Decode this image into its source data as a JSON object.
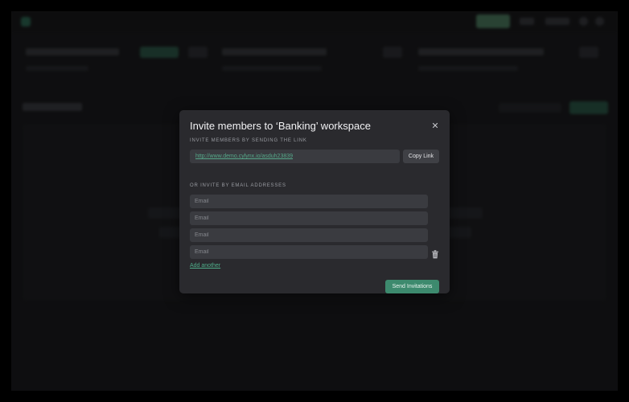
{
  "modal": {
    "title": "Invite members to ‘Banking’ workspace",
    "close_icon": "close-icon",
    "link_section_label": "INVITE MEMBERS BY SENDING THE LINK",
    "invite_link": "http://www.demo.cylynx.io/asduh23839",
    "copy_link_label": "Copy Link",
    "email_section_label": "OR INVITE BY EMAIL ADDRESSES",
    "email_fields": [
      {
        "placeholder": "Email",
        "value": ""
      },
      {
        "placeholder": "Email",
        "value": ""
      },
      {
        "placeholder": "Email",
        "value": ""
      },
      {
        "placeholder": "Email",
        "value": ""
      }
    ],
    "delete_icon": "trash-icon",
    "add_another_label": "Add another",
    "send_label": "Send Invitations"
  },
  "colors": {
    "accent": "#3d8a6e",
    "link": "#56a98a",
    "modal_bg": "#2a2a2e",
    "app_bg": "#1c1c1f"
  }
}
